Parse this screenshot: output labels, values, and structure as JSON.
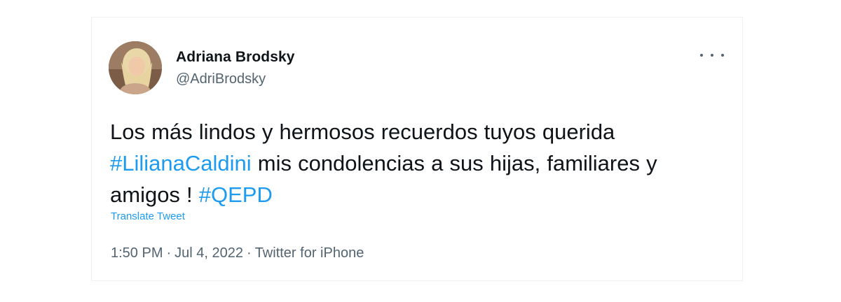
{
  "tweet": {
    "author": {
      "name": "Adriana Brodsky",
      "handle": "@AdriBrodsky"
    },
    "text": {
      "part1": "Los más lindos y hermosos recuerdos tuyos querida ",
      "hashtag1": "#LilianaCaldini",
      "part2": " mis condolencias a sus hijas, familiares y amigos ! ",
      "hashtag2": "#QEPD"
    },
    "translate_label": "Translate Tweet",
    "meta": {
      "time": "1:50 PM",
      "separator": "·",
      "date": "Jul 4, 2022",
      "source": "Twitter for iPhone"
    }
  },
  "icons": {
    "more": "more-options-icon",
    "avatar": "profile-photo"
  },
  "colors": {
    "text_primary": "#0f1419",
    "text_secondary": "#536471",
    "link": "#1d9bf0"
  }
}
